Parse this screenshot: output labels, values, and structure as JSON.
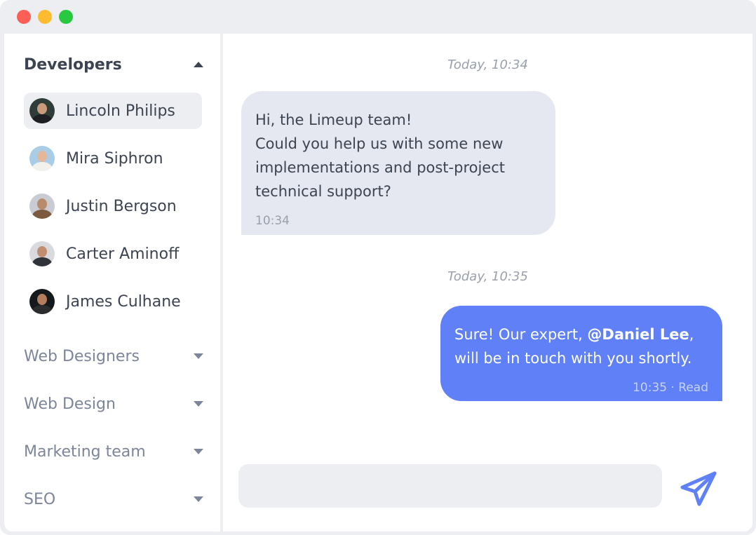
{
  "window": {
    "controls": [
      "close",
      "minimize",
      "maximize"
    ]
  },
  "sidebar": {
    "groups": [
      {
        "label": "Developers",
        "expanded": true,
        "members": [
          {
            "name": "Lincoln Philips",
            "active": true
          },
          {
            "name": "Mira Siphron",
            "active": false
          },
          {
            "name": "Justin Bergson",
            "active": false
          },
          {
            "name": "Carter Aminoff",
            "active": false
          },
          {
            "name": "James Culhane",
            "active": false
          }
        ]
      },
      {
        "label": "Web Designers",
        "expanded": false
      },
      {
        "label": "Web Design",
        "expanded": false
      },
      {
        "label": "Marketing team",
        "expanded": false
      },
      {
        "label": "SEO",
        "expanded": false
      }
    ]
  },
  "chat": {
    "messages": [
      {
        "date_label": "Today, 10:34",
        "direction": "incoming",
        "lines": [
          "Hi, the Limeup team!",
          "Could you help us with some new",
          "implementations and post-project",
          "technical support?"
        ],
        "meta": "10:34"
      },
      {
        "date_label": "Today, 10:35",
        "direction": "outgoing",
        "line1_prefix": "Sure! Our expert, ",
        "mention": "@Daniel Lee",
        "line1_suffix": ",",
        "line2": "will be in touch with you shortly.",
        "meta": "10:35 · Read"
      }
    ],
    "composer": {
      "value": "",
      "placeholder": ""
    },
    "send_icon": "paper-plane-icon"
  },
  "colors": {
    "accent": "#5f80f7",
    "incoming_bubble": "#e5e8f1",
    "active_item": "#eceef2",
    "text_primary": "#3d4451",
    "text_muted": "#7c8599",
    "close": "#fd5f57",
    "minimize": "#febc2e",
    "maximize": "#28c840"
  }
}
